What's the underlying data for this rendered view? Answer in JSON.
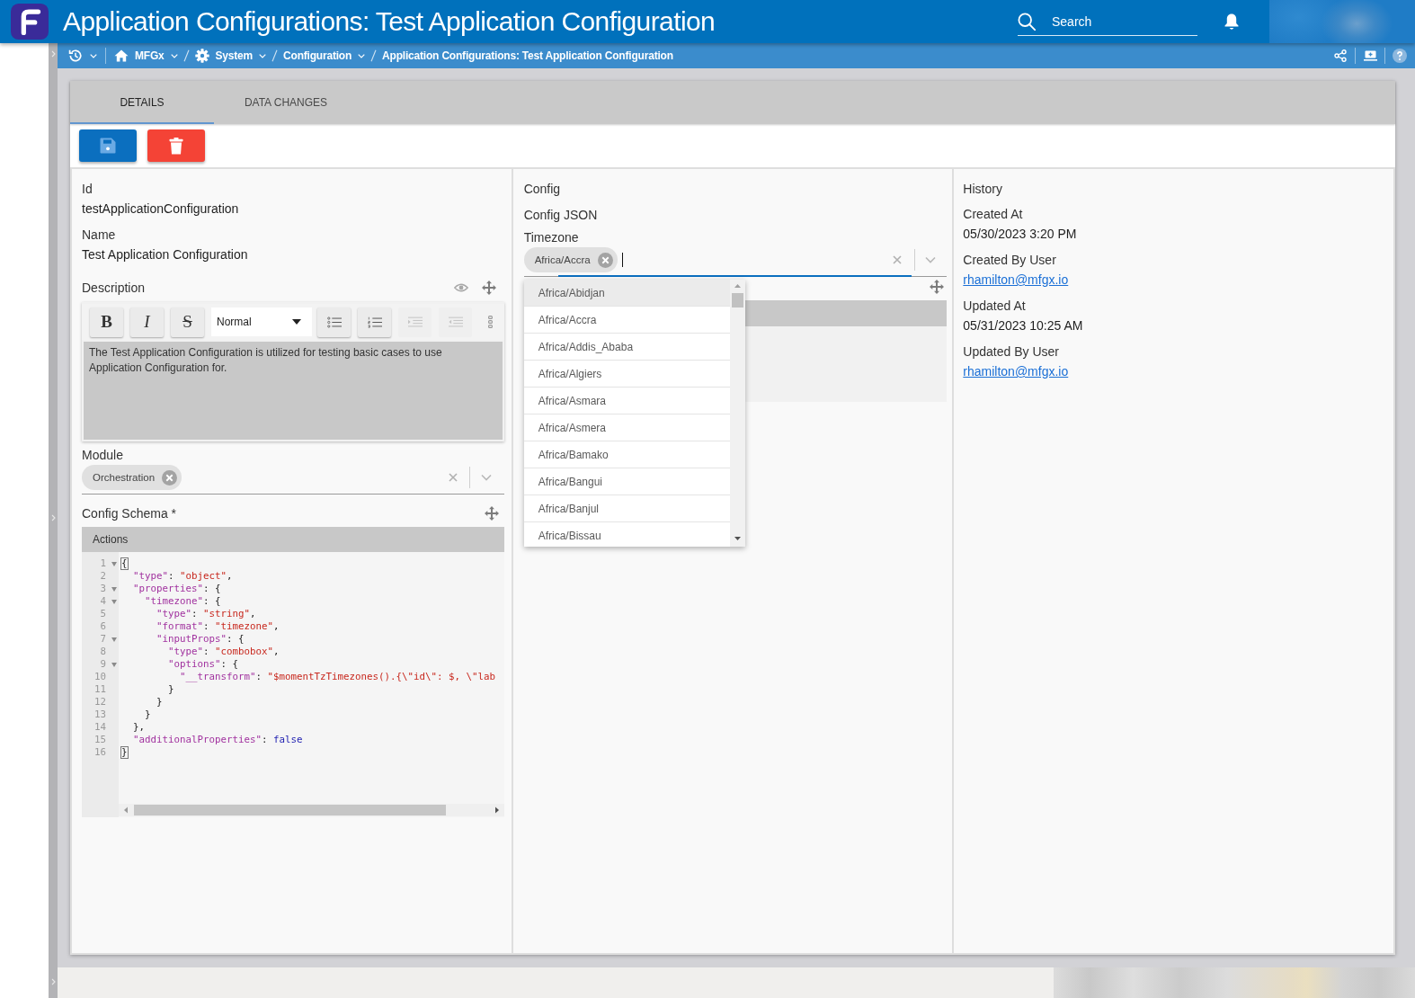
{
  "app_bar": {
    "title": "Application Configurations: Test Application Configuration",
    "search": {
      "placeholder": "Search"
    }
  },
  "breadcrumb": [
    {
      "label": "MFGx",
      "kind": "root",
      "menu": true
    },
    {
      "label": "System",
      "kind": "section",
      "menu": true
    },
    {
      "label": "Configuration",
      "kind": "page",
      "menu": true
    },
    {
      "label": "Application Configurations: Test Application Configuration",
      "kind": "page",
      "menu": false
    }
  ],
  "tabs": [
    {
      "label": "DETAILS",
      "selected": true
    },
    {
      "label": "DATA CHANGES",
      "selected": false
    }
  ],
  "details": {
    "fields": [
      {
        "label": "Id",
        "value": "testApplicationConfiguration"
      },
      {
        "label": "Name",
        "value": "Test Application Configuration"
      }
    ],
    "description": {
      "label": "Description",
      "toolbar": [
        {
          "kind": "bold",
          "label": "B",
          "disabled": false
        },
        {
          "kind": "italic",
          "label": "I",
          "disabled": false
        },
        {
          "kind": "strike",
          "label": "S",
          "disabled": false
        },
        {
          "kind": "select",
          "label": "Normal",
          "disabled": false
        },
        {
          "kind": "bullet_list",
          "disabled": false
        },
        {
          "kind": "numbered_list",
          "disabled": false
        },
        {
          "kind": "indent",
          "disabled": true
        },
        {
          "kind": "outdent",
          "disabled": true
        },
        {
          "kind": "more",
          "disabled": false
        }
      ],
      "text": "The Test Application Configuration is utilized for testing basic cases to use Application Configuration for."
    },
    "module": {
      "label": "Module",
      "chips": [
        "Orchestration"
      ]
    },
    "config_schema": {
      "label": "Config Schema *",
      "toolbar_label": "Actions",
      "lines": [
        {
          "number": "1",
          "foldable": true,
          "highlight": true,
          "tokens": [
            {
              "kind": "punct",
              "text": "{"
            }
          ]
        },
        {
          "number": "2",
          "foldable": false,
          "highlight": false,
          "tokens": [
            {
              "kind": "key",
              "text": "  \"type\""
            },
            {
              "kind": "punct",
              "text": ": "
            },
            {
              "kind": "string",
              "text": "\"object\""
            },
            {
              "kind": "punct",
              "text": ","
            }
          ]
        },
        {
          "number": "3",
          "foldable": true,
          "highlight": false,
          "tokens": [
            {
              "kind": "key",
              "text": "  \"properties\""
            },
            {
              "kind": "punct",
              "text": ": {"
            }
          ]
        },
        {
          "number": "4",
          "foldable": true,
          "highlight": false,
          "tokens": [
            {
              "kind": "key",
              "text": "    \"timezone\""
            },
            {
              "kind": "punct",
              "text": ": {"
            }
          ]
        },
        {
          "number": "5",
          "foldable": false,
          "highlight": false,
          "tokens": [
            {
              "kind": "key",
              "text": "      \"type\""
            },
            {
              "kind": "punct",
              "text": ": "
            },
            {
              "kind": "string",
              "text": "\"string\""
            },
            {
              "kind": "punct",
              "text": ","
            }
          ]
        },
        {
          "number": "6",
          "foldable": false,
          "highlight": false,
          "tokens": [
            {
              "kind": "key",
              "text": "      \"format\""
            },
            {
              "kind": "punct",
              "text": ": "
            },
            {
              "kind": "string",
              "text": "\"timezone\""
            },
            {
              "kind": "punct",
              "text": ","
            }
          ]
        },
        {
          "number": "7",
          "foldable": true,
          "highlight": false,
          "tokens": [
            {
              "kind": "key",
              "text": "      \"inputProps\""
            },
            {
              "kind": "punct",
              "text": ": {"
            }
          ]
        },
        {
          "number": "8",
          "foldable": false,
          "highlight": false,
          "tokens": [
            {
              "kind": "key",
              "text": "        \"type\""
            },
            {
              "kind": "punct",
              "text": ": "
            },
            {
              "kind": "string",
              "text": "\"combobox\""
            },
            {
              "kind": "punct",
              "text": ","
            }
          ]
        },
        {
          "number": "9",
          "foldable": true,
          "highlight": false,
          "tokens": [
            {
              "kind": "key",
              "text": "        \"options\""
            },
            {
              "kind": "punct",
              "text": ": {"
            }
          ]
        },
        {
          "number": "10",
          "foldable": false,
          "highlight": false,
          "tokens": [
            {
              "kind": "key",
              "text": "          \"__transform\""
            },
            {
              "kind": "punct",
              "text": ": "
            },
            {
              "kind": "string",
              "text": "\"$momentTzTimezones().{\\\"id\\\": $, \\\"lab"
            }
          ]
        },
        {
          "number": "11",
          "foldable": false,
          "highlight": false,
          "tokens": [
            {
              "kind": "punct",
              "text": "        }"
            }
          ]
        },
        {
          "number": "12",
          "foldable": false,
          "highlight": false,
          "tokens": [
            {
              "kind": "punct",
              "text": "      }"
            }
          ]
        },
        {
          "number": "13",
          "foldable": false,
          "highlight": false,
          "tokens": [
            {
              "kind": "punct",
              "text": "    }"
            }
          ]
        },
        {
          "number": "14",
          "foldable": false,
          "highlight": false,
          "tokens": [
            {
              "kind": "punct",
              "text": "  },"
            }
          ]
        },
        {
          "number": "15",
          "foldable": false,
          "highlight": false,
          "tokens": [
            {
              "kind": "key",
              "text": "  \"additionalProperties\""
            },
            {
              "kind": "punct",
              "text": ": "
            },
            {
              "kind": "keyword",
              "text": "false"
            }
          ]
        },
        {
          "number": "16",
          "foldable": false,
          "highlight": true,
          "tokens": [
            {
              "kind": "punct",
              "text": "}"
            }
          ]
        }
      ]
    }
  },
  "config": {
    "title": "Config",
    "subtitle": "Config JSON",
    "timezone": {
      "label": "Timezone",
      "chips": [
        "Africa/Accra"
      ],
      "focused": true,
      "options": [
        {
          "label": "Africa/Abidjan",
          "selected": true
        },
        {
          "label": "Africa/Accra",
          "selected": false
        },
        {
          "label": "Africa/Addis_Ababa",
          "selected": false
        },
        {
          "label": "Africa/Algiers",
          "selected": false
        },
        {
          "label": "Africa/Asmara",
          "selected": false
        },
        {
          "label": "Africa/Asmera",
          "selected": false
        },
        {
          "label": "Africa/Bamako",
          "selected": false
        },
        {
          "label": "Africa/Bangui",
          "selected": false
        },
        {
          "label": "Africa/Banjul",
          "selected": false
        },
        {
          "label": "Africa/Bissau",
          "selected": false
        }
      ]
    }
  },
  "history": {
    "title": "History",
    "entries": [
      {
        "label": "Created At",
        "value": "05/30/2023 3:20 PM",
        "kind": "text"
      },
      {
        "label": "Created By User",
        "value": "rhamilton@mfgx.io",
        "kind": "link"
      },
      {
        "label": "Updated At",
        "value": "05/31/2023 10:25 AM",
        "kind": "text"
      },
      {
        "label": "Updated By User",
        "value": "rhamilton@mfgx.io",
        "kind": "link"
      }
    ]
  }
}
